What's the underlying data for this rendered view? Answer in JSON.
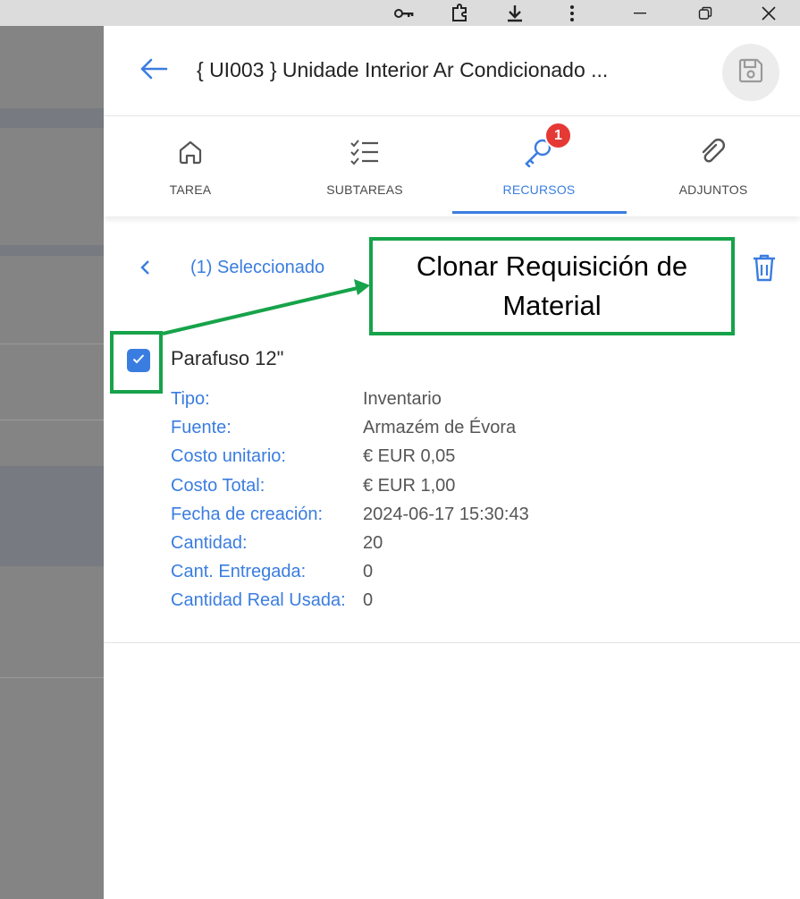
{
  "browser": {
    "icons": [
      "key-icon",
      "extension-icon",
      "download-icon",
      "more-vert-icon",
      "minimize-icon",
      "restore-icon",
      "close-icon"
    ]
  },
  "header": {
    "title": "{ UI003 } Unidade Interior Ar Condicionado ...",
    "back_icon": "arrow-left-icon",
    "save_icon": "save-icon"
  },
  "tabs": [
    {
      "label": "TAREA",
      "icon": "home-icon",
      "active": false
    },
    {
      "label": "SUBTAREAS",
      "icon": "checklist-icon",
      "active": false
    },
    {
      "label": "RECURSOS",
      "icon": "key-tool-icon",
      "active": true,
      "badge": "1"
    },
    {
      "label": "ADJUNTOS",
      "icon": "attachment-icon",
      "active": false
    }
  ],
  "selection": {
    "text": "(1) Seleccionado"
  },
  "item": {
    "name": "Parafuso 12\"",
    "checked": true,
    "fields": [
      {
        "label": "Tipo:",
        "value": "Inventario"
      },
      {
        "label": "Fuente:",
        "value": "Armazém de Évora"
      },
      {
        "label": "Costo unitario:",
        "value": "€ EUR 0,05"
      },
      {
        "label": "Costo Total:",
        "value": "€ EUR 1,00"
      },
      {
        "label": "Fecha de creación:",
        "value": "2024-06-17 15:30:43"
      },
      {
        "label": "Cantidad:",
        "value": "20"
      },
      {
        "label": "Cant. Entregada:",
        "value": "0"
      },
      {
        "label": "Cantidad Real Usada:",
        "value": "0"
      }
    ]
  },
  "annotation": {
    "line1": "Clonar Requisición de",
    "line2": "Material",
    "color": "#16a34a"
  },
  "colors": {
    "accent": "#3a7de0",
    "badge": "#e53935"
  }
}
